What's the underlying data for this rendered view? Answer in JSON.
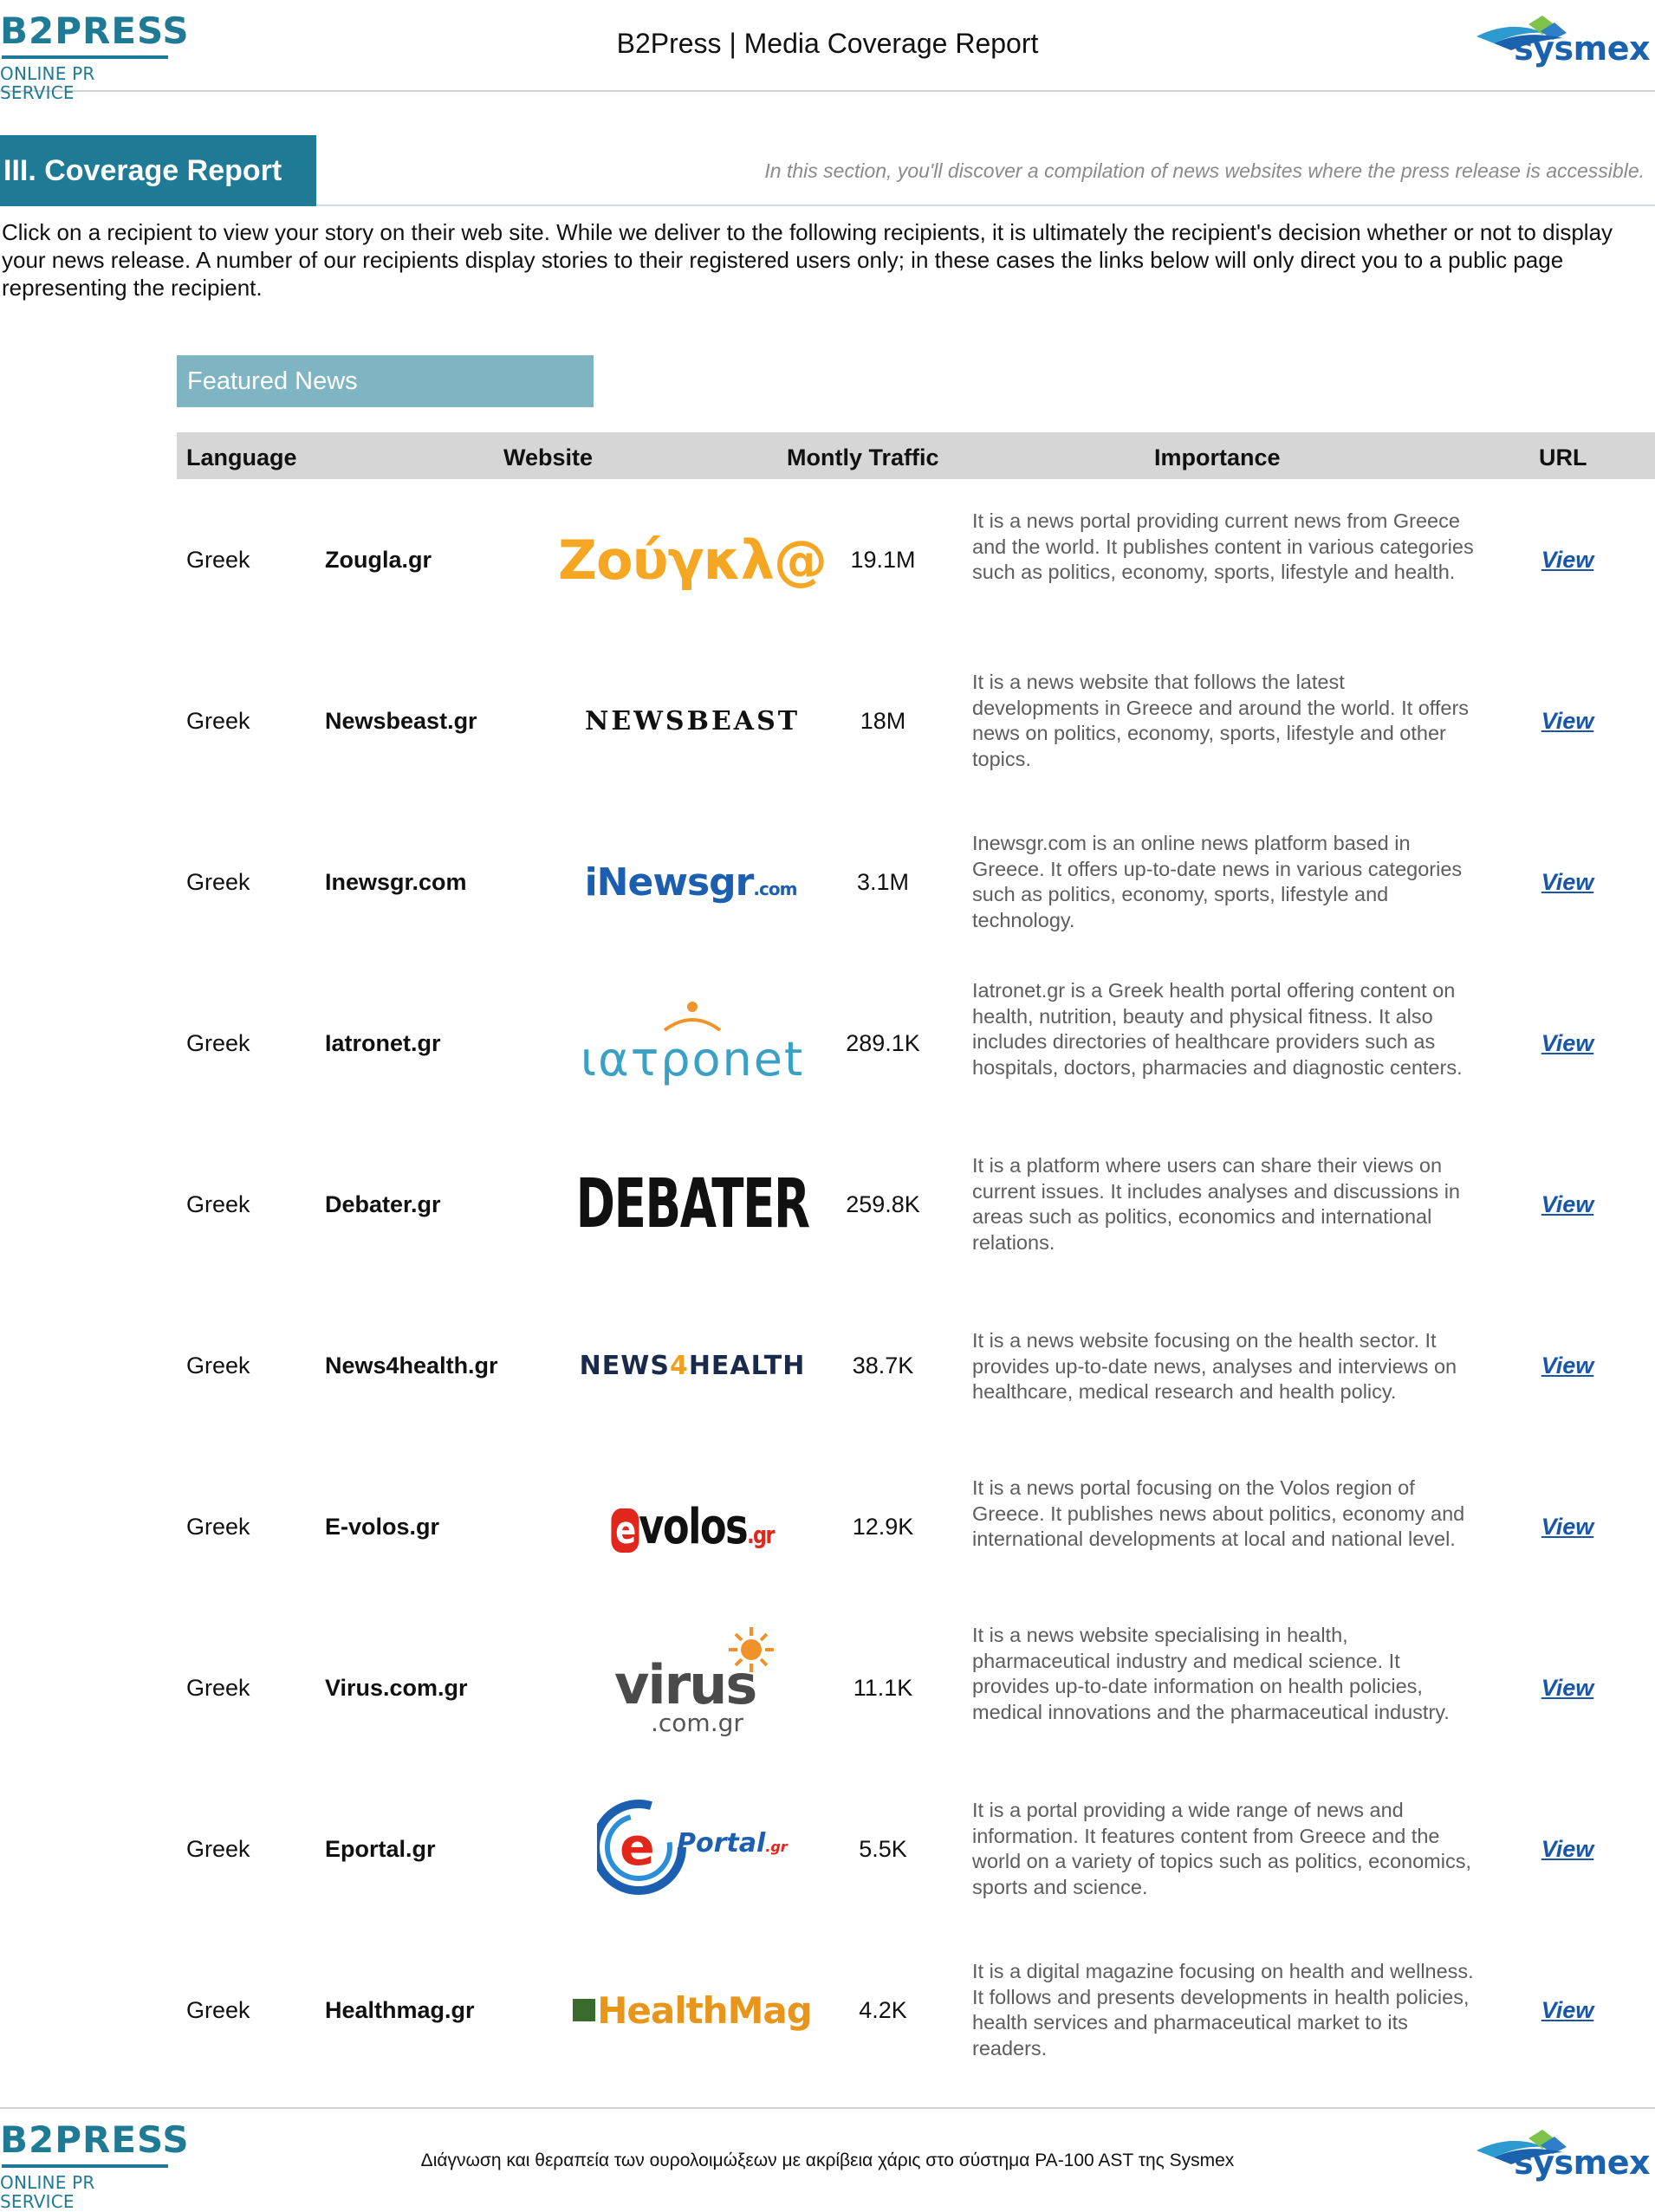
{
  "header": {
    "brand_word": "B2PRESS",
    "brand_tagline": "ONLINE PR SERVICE",
    "title": "B2Press  | Media Coverage Report",
    "partner_word": "sysmex"
  },
  "section": {
    "heading": "III. Coverage Report",
    "note": "In this section, you'll discover a compilation of news websites where the press release is accessible.",
    "paragraph": "Click on a recipient to view your story on their web site. While we deliver to the following recipients, it is ultimately the recipient's decision whether or not to display your news release. A number of our recipients display stories to their registered users only; in these cases the links below will only direct you to a public page representing the recipient."
  },
  "featured": {
    "label": "Featured News",
    "columns": {
      "language": "Language",
      "website": "Website",
      "traffic": "Montly Traffic",
      "importance": "Importance",
      "url": "URL"
    },
    "rows": [
      {
        "language": "Greek",
        "site": "Zougla.gr",
        "logo_text": "Ζούγκλ@",
        "traffic": "19.1M",
        "importance": "It is a news portal providing current news from Greece and the world. It publishes content in various categories such as politics, economy, sports, lifestyle and health.",
        "link": "View"
      },
      {
        "language": "Greek",
        "site": "Newsbeast.gr",
        "logo_text": "NEWSBEAST",
        "traffic": "18M",
        "importance": "It is a news website that follows the latest developments in Greece and around the world. It offers news on politics, economy, sports, lifestyle and other topics.",
        "link": "View"
      },
      {
        "language": "Greek",
        "site": "Inewsgr.com",
        "logo_text": "iNewsgr",
        "logo_suffix": ".com",
        "traffic": "3.1M",
        "importance": "Inewsgr.com is an online news platform based in Greece. It offers up-to-date news in various categories such as politics, economy, sports, lifestyle and technology.",
        "link": "View"
      },
      {
        "language": "Greek",
        "site": "Iatronet.gr",
        "logo_text": "ιατρonet",
        "traffic": "289.1K",
        "importance": "Iatronet.gr is a Greek health portal offering content on health, nutrition, beauty and physical fitness. It also includes directories of healthcare providers such as hospitals, doctors, pharmacies and diagnostic centers.",
        "link": "View"
      },
      {
        "language": "Greek",
        "site": "Debater.gr",
        "logo_text": "DEBATER",
        "traffic": "259.8K",
        "importance": "It is a platform where users can share their views on current issues. It includes analyses and discussions in areas such as politics, economics and international relations.",
        "link": "View"
      },
      {
        "language": "Greek",
        "site": "News4health.gr",
        "logo_text": "NEWS",
        "logo_mid": "4",
        "logo_end": "HEALTH",
        "traffic": "38.7K",
        "importance": "It is a news website focusing on the health sector. It provides up-to-date news, analyses and interviews on healthcare, medical research and health policy.",
        "link": "View"
      },
      {
        "language": "Greek",
        "site": "E-volos.gr",
        "logo_e": "e",
        "logo_text": "volos",
        "logo_suffix": ".gr",
        "traffic": "12.9K",
        "importance": "It is a news portal focusing on the Volos region of Greece. It publishes news about politics, economy and international developments at local and national level.",
        "link": "View"
      },
      {
        "language": "Greek",
        "site": "Virus.com.gr",
        "logo_text": "virus",
        "logo_suffix": ".com.gr",
        "traffic": "11.1K",
        "importance": "It is a news website specialising in health, pharmaceutical industry and medical science. It provides up-to-date information on health policies, medical innovations and the pharmaceutical industry.",
        "link": "View"
      },
      {
        "language": "Greek",
        "site": "Eportal.gr",
        "logo_text": "Portal",
        "logo_suffix": ".gr",
        "traffic": "5.5K",
        "importance": "It is a portal providing a wide range of news and information. It features content from Greece and the world on a variety of topics such as politics, economics, sports and science.",
        "link": "View"
      },
      {
        "language": "Greek",
        "site": "Healthmag.gr",
        "logo_text": "HealthMag",
        "traffic": "4.2K",
        "importance": "It is a digital magazine focusing on health and wellness. It follows and presents developments in health policies, health services and pharmaceutical market to its readers.",
        "link": "View"
      }
    ]
  },
  "footer": {
    "brand_word": "B2PRESS",
    "brand_tagline": "ONLINE PR SERVICE",
    "text": "Διάγνωση και θεραπεία των ουρολοιμώξεων με ακρίβεια χάρις στο σύστημα PA-100 AST της Sysmex",
    "partner_word": "sysmex"
  },
  "colors": {
    "brand": "#1e7a95",
    "featured": "#7fb4c2",
    "link": "#1a56a8",
    "header_band": "#d6d6d6"
  }
}
